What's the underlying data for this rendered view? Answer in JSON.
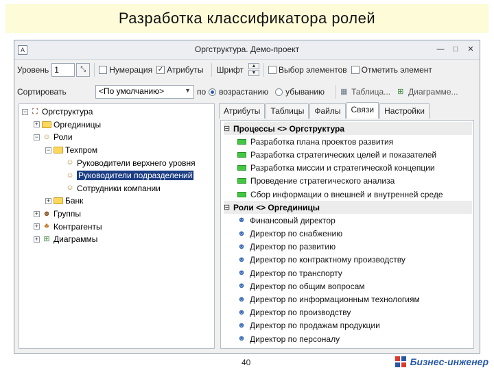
{
  "slide": {
    "title": "Разработка классификатора ролей",
    "page_number": "40",
    "brand": "Бизнес-инженер"
  },
  "window": {
    "title": "Оргструктура. Демо-проект",
    "controls": [
      "—",
      "□",
      "✕"
    ]
  },
  "toolbar": {
    "level_label": "Уровень",
    "level_value": "1",
    "numbering_label": "Нумерация",
    "numbering_checked": false,
    "attributes_label": "Атрибуты",
    "attributes_checked": true,
    "font_label": "Шрифт",
    "select_elements_label": "Выбор элементов",
    "select_elements_checked": false,
    "mark_element_label": "Отметить элемент",
    "mark_element_checked": false,
    "sort_label": "Сортировать",
    "sort_value": "<По умолчанию>",
    "sort_suffix": "по",
    "asc_label": "возрастанию",
    "asc_selected": true,
    "desc_label": "убыванию",
    "desc_selected": false,
    "table_button": "Таблица...",
    "diagram_button": "Диаграмме..."
  },
  "tree": [
    {
      "label": "Оргструктура",
      "depth": 0,
      "expander": "−",
      "icon": "orgchart-icon"
    },
    {
      "label": "Оргединицы",
      "depth": 1,
      "expander": "+",
      "icon": "folder-icon"
    },
    {
      "label": "Роли",
      "depth": 1,
      "expander": "−",
      "icon": "person-icon"
    },
    {
      "label": "Техпром",
      "depth": 2,
      "expander": "−",
      "icon": "folder-icon"
    },
    {
      "label": "Руководители верхнего уровня",
      "depth": 3,
      "expander": "",
      "icon": "person-icon"
    },
    {
      "label": "Руководители подразделений",
      "depth": 3,
      "expander": "",
      "icon": "person-icon",
      "selected": true
    },
    {
      "label": "Сотрудники компании",
      "depth": 3,
      "expander": "",
      "icon": "person-icon"
    },
    {
      "label": "Банк",
      "depth": 2,
      "expander": "+",
      "icon": "folder-icon"
    },
    {
      "label": "Группы",
      "depth": 1,
      "expander": "+",
      "icon": "group-icon"
    },
    {
      "label": "Контрагенты",
      "depth": 1,
      "expander": "+",
      "icon": "contractor-icon"
    },
    {
      "label": "Диаграммы",
      "depth": 1,
      "expander": "+",
      "icon": "diagram-icon"
    }
  ],
  "tabs": [
    {
      "label": "Атрибуты",
      "active": false
    },
    {
      "label": "Таблицы",
      "active": false
    },
    {
      "label": "Файлы",
      "active": false
    },
    {
      "label": "Связи",
      "active": true
    },
    {
      "label": "Настройки",
      "active": false
    }
  ],
  "links": {
    "processes_header": "Процессы <> Оргструктура",
    "processes": [
      "Разработка плана проектов развития",
      "Разработка стратегических целей и показателей",
      "Разработка миссии и стратегической концепции",
      "Проведение стратегического анализа",
      "Сбор информации о внешней и внутренней среде"
    ],
    "roles_header": "Роли <> Оргединицы",
    "roles": [
      "Финансовый директор",
      "Директор по снабжению",
      "Директор по развитию",
      "Директор по контрактному производству",
      "Директор по транспорту",
      "Директор по общим вопросам",
      "Директор по информационным технологиям",
      "Директор по производству",
      "Директор по продажам продукции",
      "Директор по персоналу"
    ]
  },
  "colors": {
    "title_bg": "#fefbd8",
    "process_icon": "#43c743",
    "selection": "#1c3e84",
    "brand": "#2657a8"
  }
}
